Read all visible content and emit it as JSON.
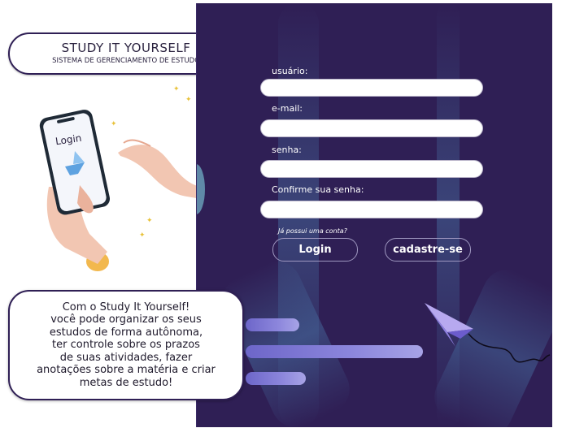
{
  "app": {
    "title": "STUDY IT YOURSELF",
    "subtitle": "SISTEMA DE GERENCIAMENTO DE ESTUDO"
  },
  "illustration": {
    "phone_screen_text": "Login"
  },
  "form": {
    "fields": [
      {
        "label": "usuário:",
        "value": "",
        "placeholder": ""
      },
      {
        "label": "e-mail:",
        "value": "",
        "placeholder": ""
      },
      {
        "label": "senha:",
        "value": "",
        "placeholder": ""
      },
      {
        "label": "Confirme sua senha:",
        "value": "",
        "placeholder": ""
      }
    ],
    "account_prompt": "Já possui uma conta?",
    "login_button": "Login",
    "signup_button": "cadastre-se"
  },
  "info": {
    "text": "Com o Study It Yourself!\nvocê pode organizar os seus\nestudos de forma autônoma,\nter controle sobre os prazos\nde suas atividades, fazer\nanotações sobre a matéria e criar\nmetas de estudo!"
  },
  "colors": {
    "panel": "#2f1f55",
    "accent": "#8c86dc",
    "sparkle": "#e8c23a"
  }
}
